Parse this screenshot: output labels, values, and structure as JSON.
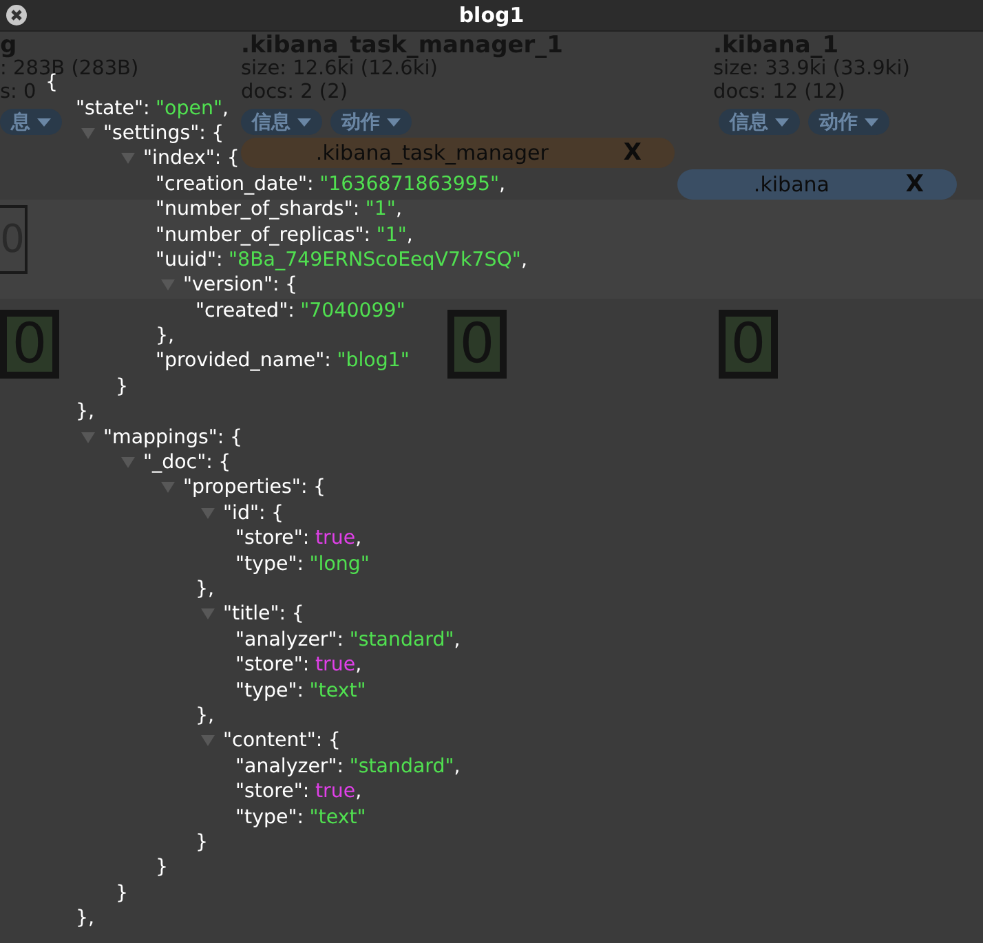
{
  "modal": {
    "title": "blog1"
  },
  "indices": [
    {
      "name": "g",
      "size": ": 283B (283B)",
      "docs": "s: 0",
      "buttons": [
        "息"
      ]
    },
    {
      "name": ".kibana_task_manager_1",
      "size": "size: 12.6ki (12.6ki)",
      "docs": "docs: 2 (2)",
      "buttons": [
        "信息",
        "动作"
      ]
    },
    {
      "name": ".kibana_1",
      "size": "size: 33.9ki (33.9ki)",
      "docs": "docs: 12 (12)",
      "buttons": [
        "信息",
        "动作"
      ]
    }
  ],
  "aliases": [
    {
      "name": ".kibana_task_manager",
      "close": "X",
      "color": "#4a3a2a"
    },
    {
      "name": ".kibana",
      "close": "X",
      "color": "#3a4e64"
    }
  ],
  "shard_rows": [
    {
      "shards": [
        {
          "label": "0",
          "kind": "unassigned"
        }
      ]
    },
    {
      "shards": [
        {
          "label": "0",
          "kind": "primary"
        },
        {
          "label": "0",
          "kind": "primary"
        },
        {
          "label": "0",
          "kind": "primary"
        }
      ]
    }
  ],
  "json_tree": {
    "open": "{",
    "children": [
      {
        "key": "\"state\":",
        "value": "\"open\"",
        "kind": "string",
        "suffix": ","
      },
      {
        "key": "\"settings\":",
        "open": "{",
        "expanded": true,
        "close": "},",
        "children": [
          {
            "key": "\"index\":",
            "open": "{",
            "expanded": true,
            "close": "}",
            "children": [
              {
                "key": "\"creation_date\":",
                "value": "\"1636871863995\"",
                "kind": "string",
                "suffix": ","
              },
              {
                "key": "\"number_of_shards\":",
                "value": "\"1\"",
                "kind": "string",
                "suffix": ","
              },
              {
                "key": "\"number_of_replicas\":",
                "value": "\"1\"",
                "kind": "string",
                "suffix": ","
              },
              {
                "key": "\"uuid\":",
                "value": "\"8Ba_749ERNScoEeqV7k7SQ\"",
                "kind": "string",
                "suffix": ","
              },
              {
                "key": "\"version\":",
                "open": "{",
                "expanded": true,
                "close": "},",
                "children": [
                  {
                    "key": "\"created\":",
                    "value": "\"7040099\"",
                    "kind": "string"
                  }
                ]
              },
              {
                "key": "\"provided_name\":",
                "value": "\"blog1\"",
                "kind": "string"
              }
            ]
          }
        ]
      },
      {
        "key": "\"mappings\":",
        "open": "{",
        "expanded": true,
        "close": "},",
        "children": [
          {
            "key": "\"_doc\":",
            "open": "{",
            "expanded": true,
            "close": "}",
            "children": [
              {
                "key": "\"properties\":",
                "open": "{",
                "expanded": true,
                "close": "}",
                "children": [
                  {
                    "key": "\"id\":",
                    "open": "{",
                    "expanded": true,
                    "close": "},",
                    "children": [
                      {
                        "key": "\"store\":",
                        "value": "true",
                        "kind": "boolean",
                        "suffix": ","
                      },
                      {
                        "key": "\"type\":",
                        "value": "\"long\"",
                        "kind": "string"
                      }
                    ]
                  },
                  {
                    "key": "\"title\":",
                    "open": "{",
                    "expanded": true,
                    "close": "},",
                    "children": [
                      {
                        "key": "\"analyzer\":",
                        "value": "\"standard\"",
                        "kind": "string",
                        "suffix": ","
                      },
                      {
                        "key": "\"store\":",
                        "value": "true",
                        "kind": "boolean",
                        "suffix": ","
                      },
                      {
                        "key": "\"type\":",
                        "value": "\"text\"",
                        "kind": "string"
                      }
                    ]
                  },
                  {
                    "key": "\"content\":",
                    "open": "{",
                    "expanded": true,
                    "close": "}",
                    "children": [
                      {
                        "key": "\"analyzer\":",
                        "value": "\"standard\"",
                        "kind": "string",
                        "suffix": ","
                      },
                      {
                        "key": "\"store\":",
                        "value": "true",
                        "kind": "boolean",
                        "suffix": ","
                      },
                      {
                        "key": "\"type\":",
                        "value": "\"text\"",
                        "kind": "string"
                      }
                    ]
                  }
                ]
              }
            ]
          }
        ]
      }
    ]
  }
}
